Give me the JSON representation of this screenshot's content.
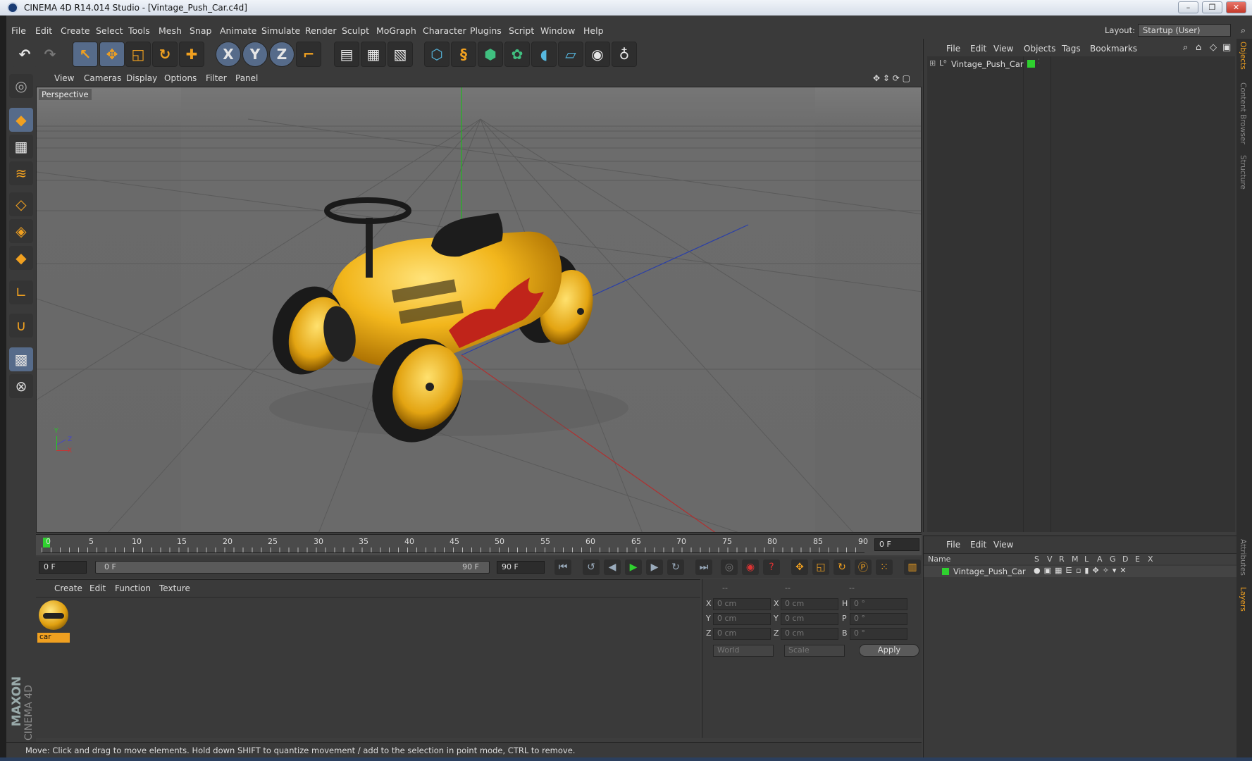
{
  "window": {
    "title": "CINEMA 4D R14.014 Studio - [Vintage_Push_Car.c4d]",
    "controls": [
      "–",
      "❐",
      "✕"
    ]
  },
  "menubar": {
    "items": [
      "File",
      "Edit",
      "Create",
      "Select",
      "Tools",
      "Mesh",
      "Snap",
      "Animate",
      "Simulate",
      "Render",
      "Sculpt",
      "MoGraph",
      "Character",
      "Plugins",
      "Script",
      "Window",
      "Help"
    ],
    "layout_label": "Layout:",
    "layout_value": "Startup (User)"
  },
  "toolbar": {
    "icons": [
      "undo-icon",
      "redo-icon",
      "live-selection-icon",
      "move-icon",
      "scale-icon",
      "rotate-icon",
      "create-icon",
      "x-axis-icon",
      "y-axis-icon",
      "z-axis-icon",
      "world-coordinate-icon",
      "render-view-icon",
      "render-picture-viewer-icon",
      "edit-render-settings-icon",
      "cube-icon",
      "spline-icon",
      "nurbs-icon",
      "array-icon",
      "deformer-icon",
      "floor-icon",
      "camera-icon",
      "light-icon"
    ],
    "axis_labels": [
      "X",
      "Y",
      "Z"
    ]
  },
  "left_tools": [
    "make-editable-icon",
    "model-mode-icon",
    "texture-mode-icon",
    "workplane-icon",
    "points-mode-icon",
    "edges-mode-icon",
    "polygons-mode-icon",
    "axis-mode-icon",
    "magnet-icon",
    "snap-icon",
    "lock-workplane-icon"
  ],
  "viewport": {
    "menus": [
      "View",
      "Cameras",
      "Display",
      "Options",
      "Filter",
      "Panel"
    ],
    "label": "Perspective",
    "axis_x": "X",
    "axis_y": "Y",
    "axis_z": "Z"
  },
  "timeline": {
    "ticks": [
      "0",
      "5",
      "10",
      "15",
      "20",
      "25",
      "30",
      "35",
      "40",
      "45",
      "50",
      "55",
      "60",
      "65",
      "70",
      "75",
      "80",
      "85",
      "90"
    ],
    "current_frame": "0 F"
  },
  "transport": {
    "start_frame": "0 F",
    "range_start": "0 F",
    "range_end": "90 F",
    "end_frame": "90 F"
  },
  "materials": {
    "menus": [
      "Create",
      "Edit",
      "Function",
      "Texture"
    ],
    "items": [
      {
        "name": "car"
      }
    ]
  },
  "coords": {
    "col_headers": [
      "--",
      "--",
      "--"
    ],
    "rows": [
      {
        "a": "X",
        "av": "0 cm",
        "b": "X",
        "bv": "0 cm",
        "c": "H",
        "cv": "0 °"
      },
      {
        "a": "Y",
        "av": "0 cm",
        "b": "Y",
        "bv": "0 cm",
        "c": "P",
        "cv": "0 °"
      },
      {
        "a": "Z",
        "av": "0 cm",
        "b": "Z",
        "bv": "0 cm",
        "c": "B",
        "cv": "0 °"
      }
    ],
    "space": "World",
    "mode": "Scale",
    "apply": "Apply"
  },
  "status": {
    "text": "Move: Click and drag to move elements. Hold down SHIFT to quantize movement / add to the selection in point mode, CTRL to remove."
  },
  "objects_panel": {
    "menus": [
      "File",
      "Edit",
      "View",
      "Objects",
      "Tags",
      "Bookmarks"
    ],
    "objects": [
      {
        "name": "Vintage_Push_Car"
      }
    ]
  },
  "layers_panel": {
    "menus": [
      "File",
      "Edit",
      "View"
    ],
    "col_name": "Name",
    "cols": [
      "S",
      "V",
      "R",
      "M",
      "L",
      "A",
      "G",
      "D",
      "E",
      "X"
    ],
    "layers": [
      {
        "name": "Vintage_Push_Car"
      }
    ]
  },
  "side_tabs": [
    "Objects",
    "Content Browser",
    "Structure",
    "Attributes",
    "Layers"
  ],
  "branding": {
    "maxon": "MAXON",
    "cinema": "CINEMA 4D"
  },
  "colors": {
    "accent": "#f0a020",
    "selection": "#566b8a",
    "layer_green": "#2fd12f",
    "car_yellow": "#f2b61c"
  }
}
